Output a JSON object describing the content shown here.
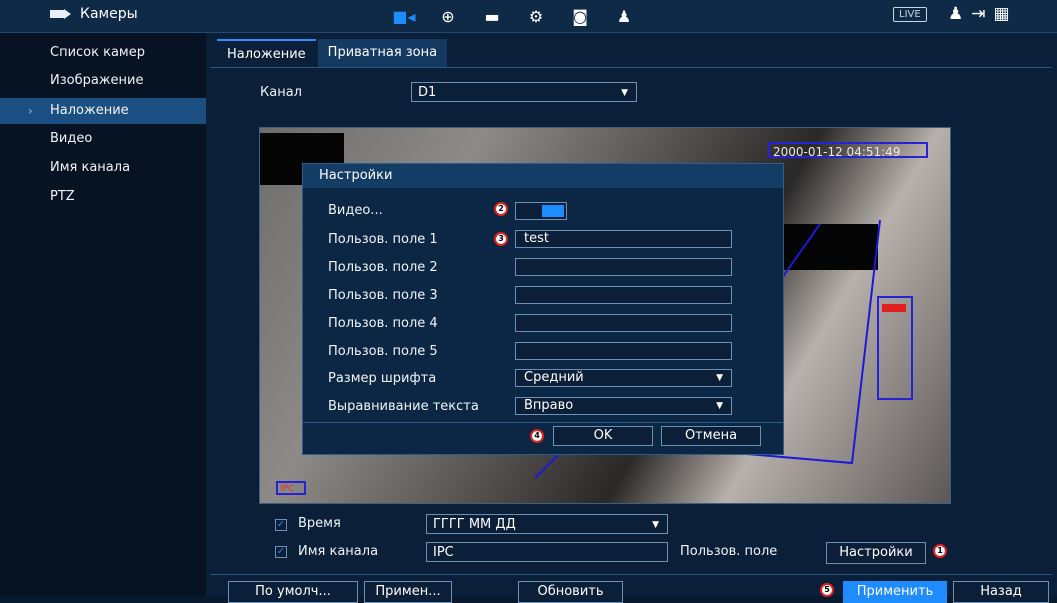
{
  "app": {
    "title": "Камеры",
    "live": "LIVE"
  },
  "sidebar": {
    "items": [
      {
        "label": "Список камер"
      },
      {
        "label": "Изображение"
      },
      {
        "label": "Наложение"
      },
      {
        "label": "Видео"
      },
      {
        "label": "Имя канала"
      },
      {
        "label": "PTZ"
      }
    ]
  },
  "tabs": [
    {
      "label": "Наложение"
    },
    {
      "label": "Приватная зона"
    }
  ],
  "channel": {
    "label": "Канал",
    "value": "D1"
  },
  "preview": {
    "timestamp": "2000-01-12 04:51:49",
    "channel_label": "IPC"
  },
  "dialog": {
    "title": "Настройки",
    "rows": [
      {
        "label": "Видео..."
      },
      {
        "label": "Пользов. поле 1",
        "value": "test"
      },
      {
        "label": "Пользов. поле 2",
        "value": ""
      },
      {
        "label": "Пользов. поле 3",
        "value": ""
      },
      {
        "label": "Пользов. поле 4",
        "value": ""
      },
      {
        "label": "Пользов. поле 5",
        "value": ""
      },
      {
        "label": "Размер шрифта",
        "value": "Средний"
      },
      {
        "label": "Выравнивание текста",
        "value": "Вправо"
      }
    ],
    "ok": "OK",
    "cancel": "Отмена"
  },
  "options": {
    "time_label": "Время",
    "time_format": "ГГГГ ММ ДД",
    "channel_name_label": "Имя канала",
    "channel_name_value": "IPC",
    "custom_field_label": "Пользов. поле",
    "settings_button": "Настройки"
  },
  "footer": {
    "default": "По умолч...",
    "apply_short": "Примен...",
    "refresh": "Обновить",
    "apply": "Применить",
    "back": "Назад"
  },
  "badges": [
    "1",
    "2",
    "3",
    "4",
    "5"
  ],
  "colors": {
    "accent": "#1e8bff",
    "badge_border": "#e02020",
    "panel": "#0b1f38"
  }
}
